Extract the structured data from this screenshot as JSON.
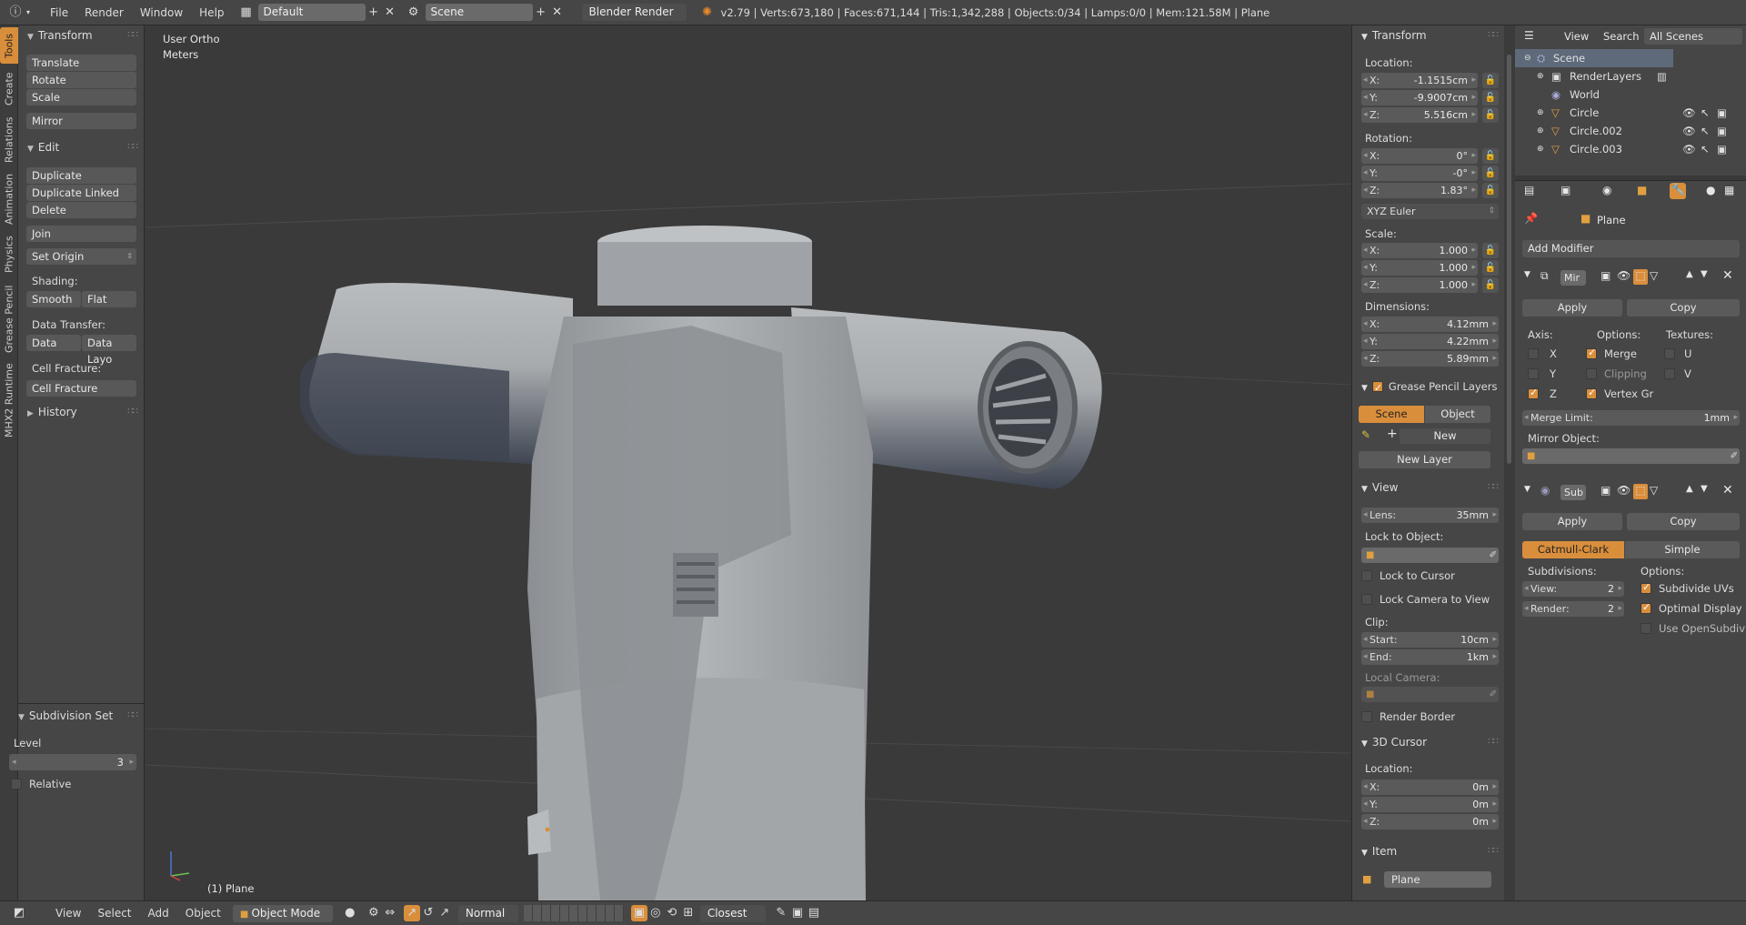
{
  "topbar": {
    "menus": [
      "File",
      "Render",
      "Window",
      "Help"
    ],
    "layout": "Default",
    "scene": "Scene",
    "engine": "Blender Render",
    "stats": "v2.79 | Verts:673,180 | Faces:671,144 | Tris:1,342,288 | Objects:0/34 | Lamps:0/0 | Mem:121.58M | Plane"
  },
  "tabs": [
    "Tools",
    "Create",
    "Relations",
    "Animation",
    "Physics",
    "Grease Pencil",
    "MHX2 Runtime"
  ],
  "shelf": {
    "transform": {
      "title": "Transform",
      "items": [
        "Translate",
        "Rotate",
        "Scale",
        "Mirror"
      ]
    },
    "edit": {
      "title": "Edit",
      "items": [
        "Duplicate",
        "Duplicate Linked",
        "Delete",
        "Join",
        "Set Origin"
      ],
      "shading_label": "Shading:",
      "smooth": "Smooth",
      "flat": "Flat",
      "data_transfer_label": "Data Transfer:",
      "data": "Data",
      "data_layo": "Data Layo",
      "cell_fracture_label": "Cell Fracture:",
      "cell_fracture": "Cell Fracture"
    },
    "history": "History",
    "subdiv": {
      "title": "Subdivision Set",
      "level_label": "Level",
      "level": "3",
      "relative": "Relative"
    }
  },
  "viewport": {
    "view_name": "User Ortho",
    "units": "Meters",
    "object_label": "(1) Plane"
  },
  "npanel": {
    "transform": {
      "title": "Transform",
      "location_label": "Location:",
      "location": [
        {
          "k": "X:",
          "v": "-1.1515cm"
        },
        {
          "k": "Y:",
          "v": "-9.9007cm"
        },
        {
          "k": "Z:",
          "v": "5.516cm"
        }
      ],
      "rotation_label": "Rotation:",
      "rotation": [
        {
          "k": "X:",
          "v": "0°"
        },
        {
          "k": "Y:",
          "v": "-0°"
        },
        {
          "k": "Z:",
          "v": "1.83°"
        }
      ],
      "rotation_mode": "XYZ Euler",
      "scale_label": "Scale:",
      "scale": [
        {
          "k": "X:",
          "v": "1.000"
        },
        {
          "k": "Y:",
          "v": "1.000"
        },
        {
          "k": "Z:",
          "v": "1.000"
        }
      ],
      "dimensions_label": "Dimensions:",
      "dimensions": [
        {
          "k": "X:",
          "v": "4.12mm"
        },
        {
          "k": "Y:",
          "v": "4.22mm"
        },
        {
          "k": "Z:",
          "v": "5.89mm"
        }
      ]
    },
    "grease": {
      "title": "Grease Pencil Layers",
      "scene": "Scene",
      "object": "Object",
      "new": "New",
      "new_layer": "New Layer"
    },
    "view": {
      "title": "View",
      "lens_label": "Lens:",
      "lens": "35mm",
      "lock_label": "Lock to Object:",
      "lock_cursor": "Lock to Cursor",
      "lock_camera": "Lock Camera to View",
      "clip_label": "Clip:",
      "start_label": "Start:",
      "start": "10cm",
      "end_label": "End:",
      "end": "1km",
      "local_camera": "Local Camera:",
      "render_border": "Render Border"
    },
    "cursor": {
      "title": "3D Cursor",
      "location_label": "Location:",
      "loc": [
        {
          "k": "X:",
          "v": "0m"
        },
        {
          "k": "Y:",
          "v": "0m"
        },
        {
          "k": "Z:",
          "v": "0m"
        }
      ]
    },
    "item": {
      "title": "Item",
      "name": "Plane"
    }
  },
  "outliner": {
    "header": {
      "view": "View",
      "search": "Search",
      "scenes": "All Scenes"
    },
    "rows": [
      "Scene",
      "RenderLayers",
      "World",
      "Circle",
      "Circle.002",
      "Circle.003"
    ]
  },
  "props": {
    "object": "Plane",
    "add_modifier": "Add Modifier",
    "mirror": {
      "name": "Mir",
      "apply": "Apply",
      "copy": "Copy",
      "axis": "Axis:",
      "options": "Options:",
      "textures": "Textures:",
      "x": "X",
      "y": "Y",
      "z": "Z",
      "merge": "Merge",
      "clipping": "Clipping",
      "vertex_gr": "Vertex Gr",
      "u": "U",
      "v": "V",
      "merge_limit_label": "Merge Limit:",
      "merge_limit": "1mm",
      "mirror_object": "Mirror Object:"
    },
    "subsurf": {
      "name": "Sub",
      "apply": "Apply",
      "copy": "Copy",
      "catmull": "Catmull-Clark",
      "simple": "Simple",
      "subdivisions": "Subdivisions:",
      "options": "Options:",
      "view_label": "View:",
      "view": "2",
      "render_label": "Render:",
      "render": "2",
      "subdivide_uvs": "Subdivide UVs",
      "optimal_display": "Optimal Display",
      "use_opensubdiv": "Use OpenSubdiv"
    }
  },
  "bottombar": {
    "menus": [
      "View",
      "Select",
      "Add",
      "Object"
    ],
    "mode": "Object Mode",
    "pivot": "Normal",
    "snap": "Closest"
  },
  "colors": {
    "accent": "#d98e3c",
    "panel": "#464646",
    "viewport": "#3a3a3a"
  }
}
